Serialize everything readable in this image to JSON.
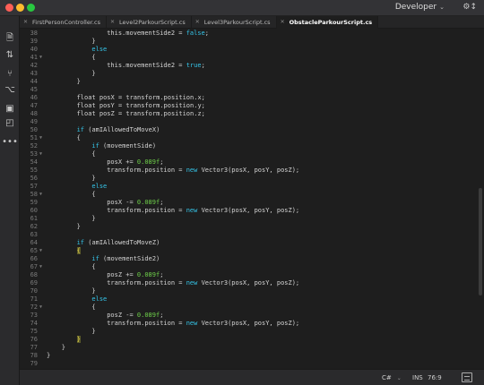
{
  "window": {
    "profile_label": "Developer",
    "profile_caret": "⌄",
    "settings_icon": "⚙↕"
  },
  "activity_bar": [
    {
      "name": "explorer-icon",
      "glyph": "🗎"
    },
    {
      "name": "sort-icon",
      "glyph": "⇅"
    },
    {
      "name": "git-branch-icon",
      "glyph": "⑂"
    },
    {
      "name": "debug-icon",
      "glyph": "⌥"
    },
    {
      "name": "extensions-icon",
      "glyph": "▣"
    },
    {
      "name": "preview-icon",
      "glyph": "◰"
    },
    {
      "name": "more-icon",
      "glyph": "•••"
    }
  ],
  "tabs": [
    {
      "label": "FirstPersonController.cs",
      "active": false
    },
    {
      "label": "Level2ParkourScript.cs",
      "active": false
    },
    {
      "label": "Level3ParkourScript.cs",
      "active": false
    },
    {
      "label": "ObstacleParkourScript.cs",
      "active": true
    }
  ],
  "tab_close_glyph": "✕",
  "colors": {
    "keyword": "#35c4e8",
    "number": "#6fd14a",
    "text": "#d4d4d4",
    "line_number": "#7a7a7a",
    "background": "#1e1e1e"
  },
  "editor": {
    "lines": [
      {
        "n": "38",
        "fold": false,
        "indent": 8,
        "tokens": [
          [
            "this.movementSide2 = ",
            "t"
          ],
          [
            "false",
            "k"
          ],
          [
            ";",
            "t"
          ]
        ]
      },
      {
        "n": "39",
        "fold": false,
        "indent": 6,
        "tokens": [
          [
            "}",
            "t"
          ]
        ]
      },
      {
        "n": "40",
        "fold": false,
        "indent": 6,
        "tokens": [
          [
            "else",
            "k"
          ]
        ]
      },
      {
        "n": "41",
        "fold": true,
        "indent": 6,
        "tokens": [
          [
            "{",
            "t"
          ]
        ]
      },
      {
        "n": "42",
        "fold": false,
        "indent": 8,
        "tokens": [
          [
            "this.movementSide2 = ",
            "t"
          ],
          [
            "true",
            "k"
          ],
          [
            ";",
            "t"
          ]
        ]
      },
      {
        "n": "43",
        "fold": false,
        "indent": 6,
        "tokens": [
          [
            "}",
            "t"
          ]
        ]
      },
      {
        "n": "44",
        "fold": false,
        "indent": 4,
        "tokens": [
          [
            "}",
            "t"
          ]
        ]
      },
      {
        "n": "45",
        "fold": false,
        "indent": 0,
        "tokens": []
      },
      {
        "n": "46",
        "fold": false,
        "indent": 4,
        "tokens": [
          [
            "float posX = transform.position.x;",
            "t"
          ]
        ]
      },
      {
        "n": "47",
        "fold": false,
        "indent": 4,
        "tokens": [
          [
            "float posY = transform.position.y;",
            "t"
          ]
        ]
      },
      {
        "n": "48",
        "fold": false,
        "indent": 4,
        "tokens": [
          [
            "float posZ = transform.position.z;",
            "t"
          ]
        ]
      },
      {
        "n": "49",
        "fold": false,
        "indent": 0,
        "tokens": []
      },
      {
        "n": "50",
        "fold": false,
        "indent": 4,
        "tokens": [
          [
            "if",
            "k"
          ],
          [
            " (amIAllowedToMoveX)",
            "t"
          ]
        ]
      },
      {
        "n": "51",
        "fold": true,
        "indent": 4,
        "tokens": [
          [
            "{",
            "t"
          ]
        ]
      },
      {
        "n": "52",
        "fold": false,
        "indent": 6,
        "tokens": [
          [
            "if",
            "k"
          ],
          [
            " (movementSide)",
            "t"
          ]
        ]
      },
      {
        "n": "53",
        "fold": true,
        "indent": 6,
        "tokens": [
          [
            "{",
            "t"
          ]
        ]
      },
      {
        "n": "54",
        "fold": false,
        "indent": 8,
        "tokens": [
          [
            "posX += ",
            "t"
          ],
          [
            "0.089f",
            "n"
          ],
          [
            ";",
            "t"
          ]
        ]
      },
      {
        "n": "55",
        "fold": false,
        "indent": 8,
        "tokens": [
          [
            "transform.position = ",
            "t"
          ],
          [
            "new",
            "k"
          ],
          [
            " Vector3(posX, posY, posZ);",
            "t"
          ]
        ]
      },
      {
        "n": "56",
        "fold": false,
        "indent": 6,
        "tokens": [
          [
            "}",
            "t"
          ]
        ]
      },
      {
        "n": "57",
        "fold": false,
        "indent": 6,
        "tokens": [
          [
            "else",
            "k"
          ]
        ]
      },
      {
        "n": "58",
        "fold": true,
        "indent": 6,
        "tokens": [
          [
            "{",
            "t"
          ]
        ]
      },
      {
        "n": "59",
        "fold": false,
        "indent": 8,
        "tokens": [
          [
            "posX -= ",
            "t"
          ],
          [
            "0.089f",
            "n"
          ],
          [
            ";",
            "t"
          ]
        ]
      },
      {
        "n": "60",
        "fold": false,
        "indent": 8,
        "tokens": [
          [
            "transform.position = ",
            "t"
          ],
          [
            "new",
            "k"
          ],
          [
            " Vector3(posX, posY, posZ);",
            "t"
          ]
        ]
      },
      {
        "n": "61",
        "fold": false,
        "indent": 6,
        "tokens": [
          [
            "}",
            "t"
          ]
        ]
      },
      {
        "n": "62",
        "fold": false,
        "indent": 4,
        "tokens": [
          [
            "}",
            "t"
          ]
        ]
      },
      {
        "n": "63",
        "fold": false,
        "indent": 0,
        "tokens": []
      },
      {
        "n": "64",
        "fold": false,
        "indent": 4,
        "tokens": [
          [
            "if",
            "k"
          ],
          [
            " (amIAllowedToMoveZ)",
            "t"
          ]
        ]
      },
      {
        "n": "65",
        "fold": true,
        "indent": 4,
        "tokens": [
          [
            "{",
            "c"
          ]
        ]
      },
      {
        "n": "66",
        "fold": false,
        "indent": 6,
        "tokens": [
          [
            "if",
            "k"
          ],
          [
            " (movementSide2)",
            "t"
          ]
        ]
      },
      {
        "n": "67",
        "fold": true,
        "indent": 6,
        "tokens": [
          [
            "{",
            "t"
          ]
        ]
      },
      {
        "n": "68",
        "fold": false,
        "indent": 8,
        "tokens": [
          [
            "posZ += ",
            "t"
          ],
          [
            "0.089f",
            "n"
          ],
          [
            ";",
            "t"
          ]
        ]
      },
      {
        "n": "69",
        "fold": false,
        "indent": 8,
        "tokens": [
          [
            "transform.position = ",
            "t"
          ],
          [
            "new",
            "k"
          ],
          [
            " Vector3(posX, posY, posZ);",
            "t"
          ]
        ]
      },
      {
        "n": "70",
        "fold": false,
        "indent": 6,
        "tokens": [
          [
            "}",
            "t"
          ]
        ]
      },
      {
        "n": "71",
        "fold": false,
        "indent": 6,
        "tokens": [
          [
            "else",
            "k"
          ]
        ]
      },
      {
        "n": "72",
        "fold": true,
        "indent": 6,
        "tokens": [
          [
            "{",
            "t"
          ]
        ]
      },
      {
        "n": "73",
        "fold": false,
        "indent": 8,
        "tokens": [
          [
            "posZ -= ",
            "t"
          ],
          [
            "0.089f",
            "n"
          ],
          [
            ";",
            "t"
          ]
        ]
      },
      {
        "n": "74",
        "fold": false,
        "indent": 8,
        "tokens": [
          [
            "transform.position = ",
            "t"
          ],
          [
            "new",
            "k"
          ],
          [
            " Vector3(posX, posY, posZ);",
            "t"
          ]
        ]
      },
      {
        "n": "75",
        "fold": false,
        "indent": 6,
        "tokens": [
          [
            "}",
            "t"
          ]
        ]
      },
      {
        "n": "76",
        "fold": false,
        "indent": 4,
        "tokens": [
          [
            "}",
            "c"
          ]
        ]
      },
      {
        "n": "77",
        "fold": false,
        "indent": 2,
        "tokens": [
          [
            "}",
            "t"
          ]
        ]
      },
      {
        "n": "78",
        "fold": false,
        "indent": 0,
        "tokens": [
          [
            "}",
            "t"
          ]
        ]
      },
      {
        "n": "79",
        "fold": false,
        "indent": 0,
        "tokens": []
      }
    ]
  },
  "statusbar": {
    "language": "C#",
    "language_caret": "⌄",
    "mode": "INS",
    "cursor_position": "76:9",
    "preview_icon": "preview"
  }
}
